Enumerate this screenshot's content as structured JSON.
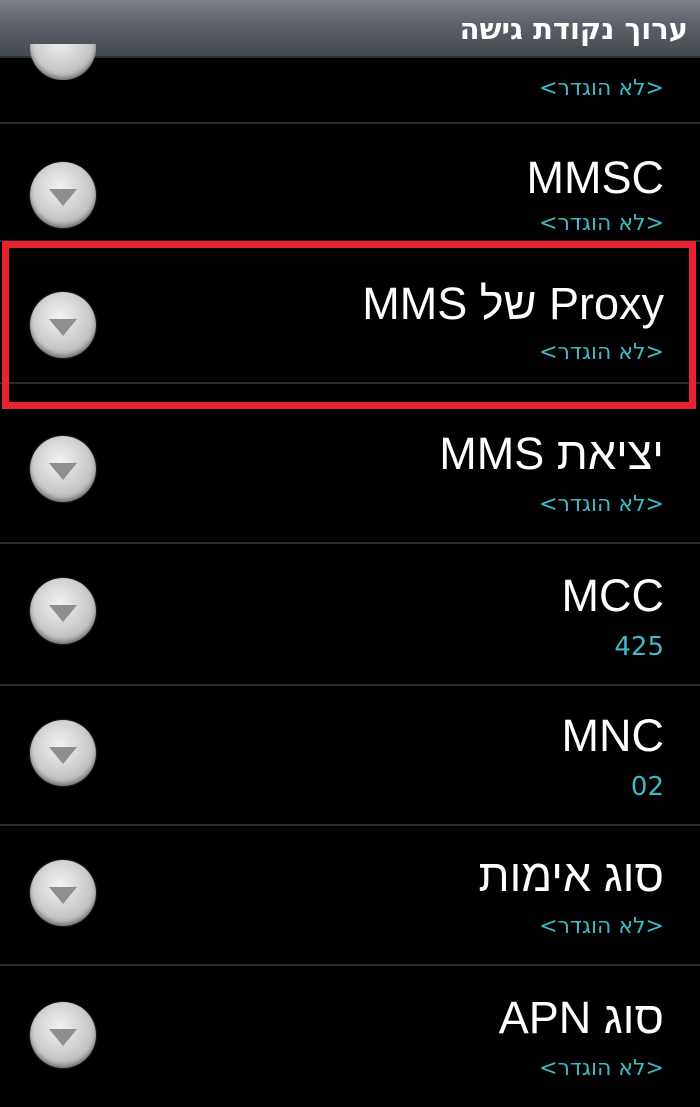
{
  "header": {
    "title": "ערוך נקודת גישה"
  },
  "list": {
    "partial_item": {
      "value": "<לא הוגדר>"
    },
    "items": [
      {
        "label": "MMSC",
        "value": "<לא הוגדר>"
      },
      {
        "label": "Proxy של MMS",
        "value": "<לא הוגדר>"
      },
      {
        "label": "יציאת MMS",
        "value": "<לא הוגדר>"
      },
      {
        "label": "MCC",
        "value": "425"
      },
      {
        "label": "MNC",
        "value": "02"
      },
      {
        "label": "סוג אימות",
        "value": "<לא הוגדר>"
      },
      {
        "label": "סוג APN",
        "value": "<לא הוגדר>"
      }
    ]
  },
  "colors": {
    "highlight": "#e8222e",
    "value_text": "#3fb8c8",
    "background": "#000000"
  },
  "icons": {
    "row_action": "chevron-down-icon"
  }
}
